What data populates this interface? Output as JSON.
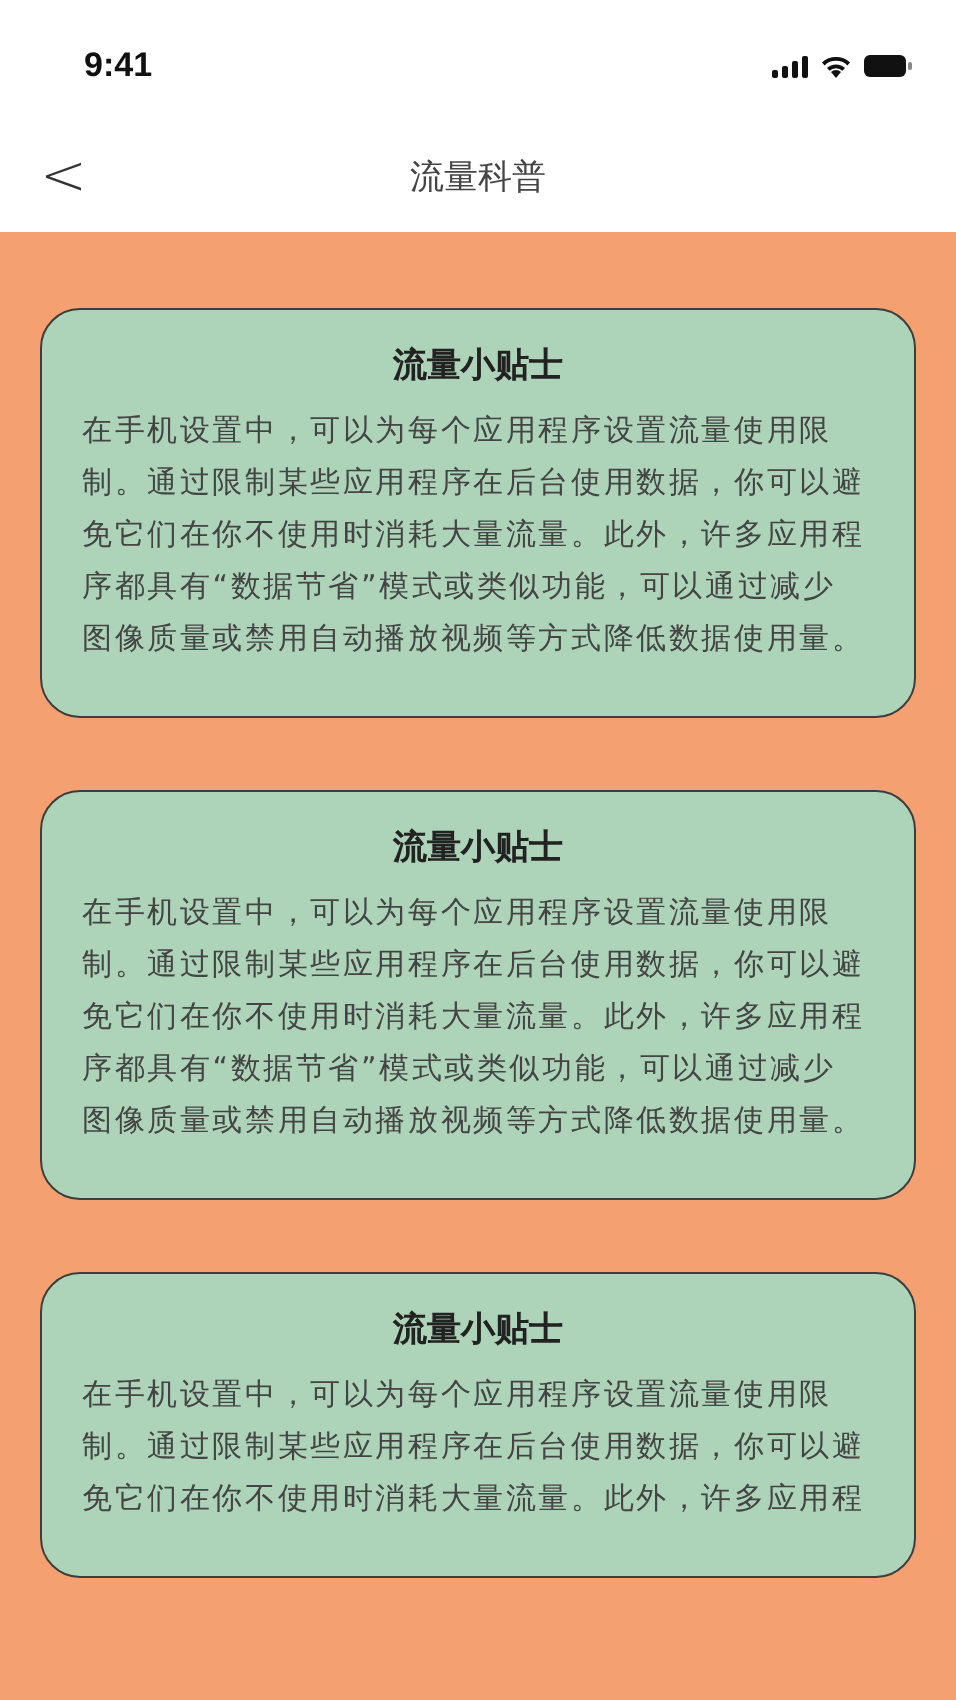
{
  "status_bar": {
    "time": "9:41"
  },
  "nav": {
    "back": "<",
    "title": "流量科普"
  },
  "cards": [
    {
      "title": "流量小贴士",
      "body": "在手机设置中，可以为每个应用程序设置流量使用限制。通过限制某些应用程序在后台使用数据，你可以避免它们在你不使用时消耗大量流量。此外，许多应用程序都具有“数据节省”模式或类似功能，可以通过减少图像质量或禁用自动播放视频等方式降低数据使用量。"
    },
    {
      "title": "流量小贴士",
      "body": "在手机设置中，可以为每个应用程序设置流量使用限制。通过限制某些应用程序在后台使用数据，你可以避免它们在你不使用时消耗大量流量。此外，许多应用程序都具有“数据节省”模式或类似功能，可以通过减少图像质量或禁用自动播放视频等方式降低数据使用量。"
    },
    {
      "title": "流量小贴士",
      "body": "在手机设置中，可以为每个应用程序设置流量使用限制。通过限制某些应用程序在后台使用数据，你可以避免它们在你不使用时消耗大量流量。此外，许多应用程"
    }
  ]
}
